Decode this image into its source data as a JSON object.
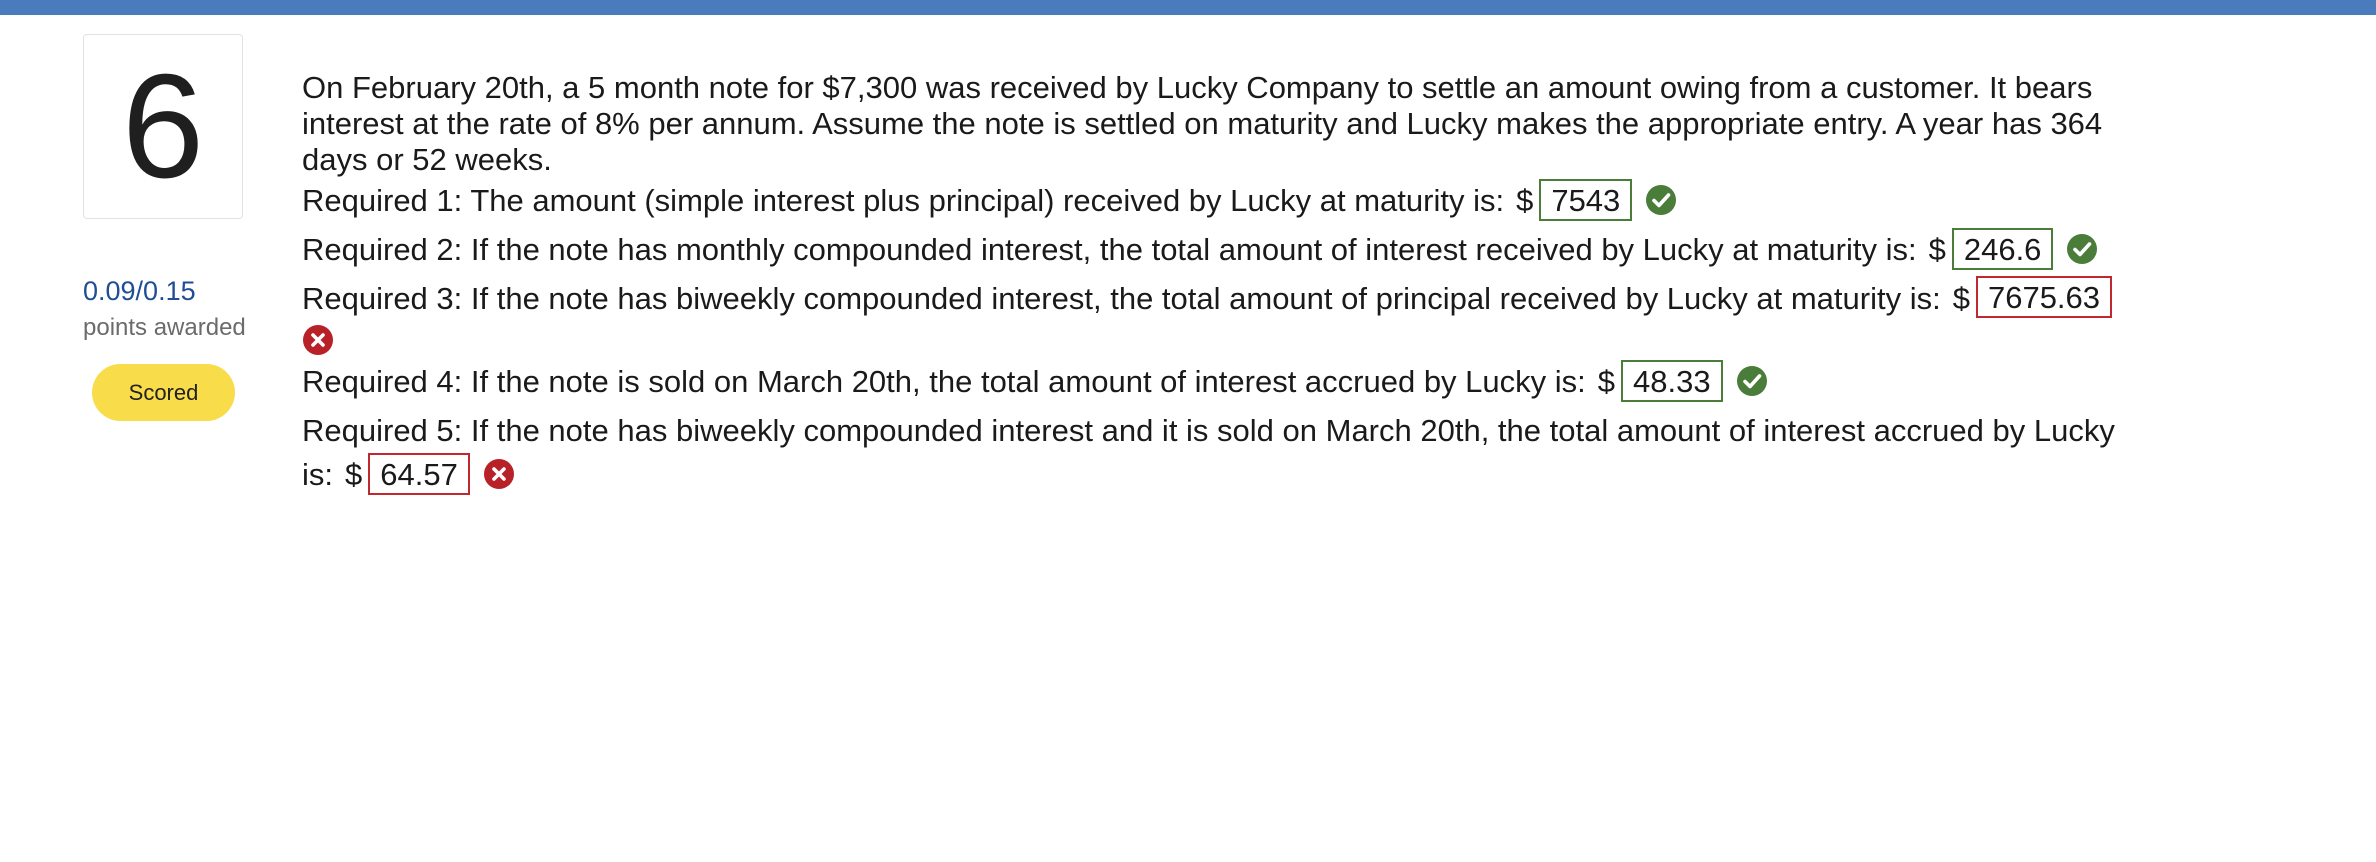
{
  "question": {
    "number": "6",
    "points": "0.09/0.15",
    "points_label": "points awarded",
    "status": "Scored",
    "stem": "On February 20th, a 5 month note for  $7,300 was received by Lucky Company to settle an amount owing from a customer. It bears interest at the rate of 8% per annum.  Assume the note is settled on maturity and Lucky makes the appropriate entry. A year has 364 days or 52 weeks."
  },
  "colors": {
    "top_bar": "#4a7bbd",
    "points": "#1f4e96",
    "badge": "#f8dc4a",
    "correct": "#4a7c3a",
    "wrong": "#c0282f"
  },
  "currency": "$",
  "requirements": [
    {
      "text": "Required 1: The amount (simple interest plus principal) received by Lucky at maturity is:",
      "answer": "7543",
      "result": "correct",
      "icon": "check-circle-icon"
    },
    {
      "text": "Required 2: If the note has monthly compounded interest, the total amount of interest received by Lucky at maturity is:",
      "answer": "246.6",
      "result": "correct",
      "icon": "check-circle-icon"
    },
    {
      "text": "Required 3: If the note has biweekly compounded interest, the total amount of principal received by Lucky at maturity is:",
      "answer": "7675.63",
      "result": "incorrect",
      "icon": "x-circle-icon"
    },
    {
      "text": "Required 4: If the note is sold on March 20th, the total amount of interest accrued by Lucky is:",
      "answer": "48.33",
      "result": "correct",
      "icon": "check-circle-icon"
    },
    {
      "text": "Required 5: If the note has biweekly compounded interest and it is sold on March 20th, the total amount of interest accrued by Lucky is:",
      "answer": "64.57",
      "result": "incorrect",
      "icon": "x-circle-icon"
    }
  ]
}
